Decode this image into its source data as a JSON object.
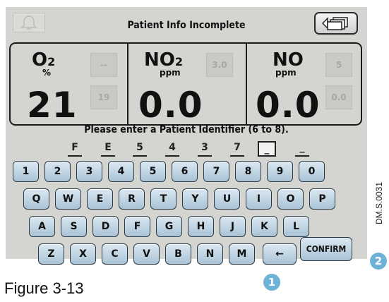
{
  "header": {
    "status_title": "Patient Info Incomplete",
    "left_icon": "alarm-silence-bell-icon",
    "right_icon": "back-windows-icon"
  },
  "gases": [
    {
      "name": "O",
      "sub": "2",
      "unit": "%",
      "value": "21",
      "alarm_high": "--",
      "alarm_low": "19"
    },
    {
      "name": "NO",
      "sub": "2",
      "unit": "ppm",
      "value": "0.0",
      "alarm_high": "3.0",
      "alarm_low": ""
    },
    {
      "name": "NO",
      "sub": "",
      "unit": "ppm",
      "value": "0.0",
      "alarm_high": "5",
      "alarm_low": "0.0"
    }
  ],
  "prompt": "Please enter a Patient Identifier (6 to 8).",
  "identifier": [
    "F",
    "E",
    "5",
    "4",
    "3",
    "7",
    "_",
    "_"
  ],
  "keyboard": {
    "row1": [
      "1",
      "2",
      "3",
      "4",
      "5",
      "6",
      "7",
      "8",
      "9",
      "0"
    ],
    "row2": [
      "Q",
      "W",
      "E",
      "R",
      "T",
      "Y",
      "U",
      "I",
      "O",
      "P"
    ],
    "row3": [
      "A",
      "S",
      "D",
      "F",
      "G",
      "H",
      "J",
      "K",
      "L"
    ],
    "row4": [
      "Z",
      "X",
      "C",
      "V",
      "B",
      "N",
      "M",
      "←"
    ],
    "confirm": "CONFIRM"
  },
  "callouts": [
    "1",
    "2"
  ],
  "doc_id": "DM.S.0031",
  "caption": "Figure 3-13",
  "colors": {
    "screen_bg": "#d4d4d0",
    "key_fill": "#b8cfe0",
    "callout": "#6fb2d8"
  }
}
